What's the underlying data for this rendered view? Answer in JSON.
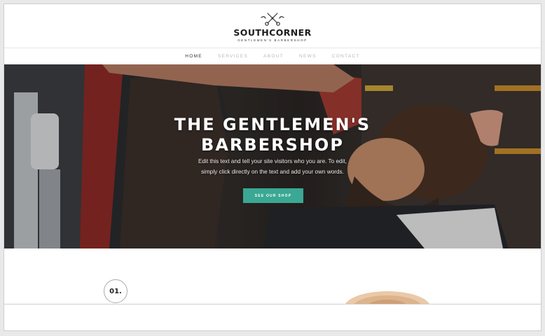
{
  "header": {
    "brand": "SOUTHCORNER",
    "tagline": "GENTLEMEN'S BARBERSHOP"
  },
  "nav": {
    "items": [
      {
        "label": "HOME"
      },
      {
        "label": "SERVICES"
      },
      {
        "label": "ABOUT"
      },
      {
        "label": "NEWS"
      },
      {
        "label": "CONTACT"
      }
    ]
  },
  "hero": {
    "title_line1": "THE GENTLEMEN'S",
    "title_line2": "BARBERSHOP",
    "sub_line1": "Edit this text and tell your site visitors who you are. To edit,",
    "sub_line2": "simply click directly on the text and add your own words.",
    "cta": "SEE OUR SHOP"
  },
  "section": {
    "number": "01."
  },
  "colors": {
    "accent": "#3aa894",
    "nav_active": "#333333",
    "nav_inactive": "#b9b9b9"
  },
  "icons": [
    "scissors-razor-logo-icon"
  ]
}
